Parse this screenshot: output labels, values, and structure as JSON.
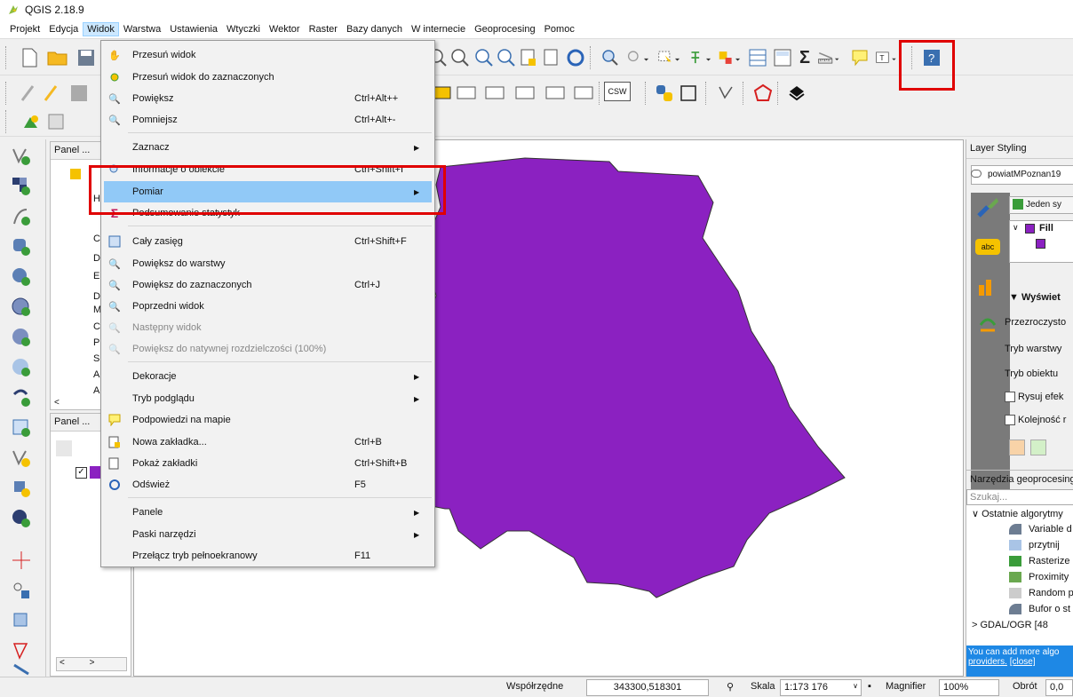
{
  "app": {
    "title": "QGIS 2.18.9"
  },
  "menubar": [
    "Projekt",
    "Edycja",
    "Widok",
    "Warstwa",
    "Ustawienia",
    "Wtyczki",
    "Wektor",
    "Raster",
    "Bazy danych",
    "W internecie",
    "Geoprocesing",
    "Pomoc"
  ],
  "menubar_active": "Widok",
  "view_menu": [
    {
      "label": "Przesuń widok",
      "shortcut": "",
      "icon": "hand-icon"
    },
    {
      "label": "Przesuń widok do zaznaczonych",
      "shortcut": "",
      "icon": "pan-to-selected-icon"
    },
    {
      "label": "Powiększ",
      "shortcut": "Ctrl+Alt++",
      "icon": "zoom-in-icon"
    },
    {
      "label": "Pomniejsz",
      "shortcut": "Ctrl+Alt+-",
      "icon": "zoom-out-icon"
    },
    {
      "label": "Zaznacz",
      "shortcut": "",
      "icon": "",
      "submenu": true
    },
    {
      "label": "Informacje o obiekcie",
      "shortcut": "Ctrl+Shift+I",
      "icon": "identify-icon"
    },
    {
      "label": "Pomiar",
      "shortcut": "",
      "icon": "",
      "submenu": true,
      "highlighted": true
    },
    {
      "label": "Podsumowanie statystyk",
      "shortcut": "",
      "icon": "sigma-icon"
    },
    {
      "label": "Cały zasięg",
      "shortcut": "Ctrl+Shift+F",
      "icon": "zoom-full-icon"
    },
    {
      "label": "Powiększ do warstwy",
      "shortcut": "",
      "icon": "zoom-layer-icon"
    },
    {
      "label": "Powiększ do zaznaczonych",
      "shortcut": "Ctrl+J",
      "icon": "zoom-selected-icon"
    },
    {
      "label": "Poprzedni widok",
      "shortcut": "",
      "icon": "zoom-last-icon"
    },
    {
      "label": "Następny widok",
      "shortcut": "",
      "icon": "zoom-next-icon",
      "disabled": true
    },
    {
      "label": "Powiększ do natywnej rozdzielczości (100%)",
      "shortcut": "",
      "icon": "zoom-native-icon",
      "disabled": true
    },
    {
      "label": "Dekoracje",
      "shortcut": "",
      "icon": "",
      "submenu": true
    },
    {
      "label": "Tryb podglądu",
      "shortcut": "",
      "icon": "",
      "submenu": true
    },
    {
      "label": "Podpowiedzi na mapie",
      "shortcut": "",
      "icon": "map-tips-icon"
    },
    {
      "label": "Nowa zakładka...",
      "shortcut": "Ctrl+B",
      "icon": "new-bookmark-icon"
    },
    {
      "label": "Pokaż zakładki",
      "shortcut": "Ctrl+Shift+B",
      "icon": "show-bookmarks-icon"
    },
    {
      "label": "Odśwież",
      "shortcut": "F5",
      "icon": "refresh-icon"
    },
    {
      "label": "Panele",
      "shortcut": "",
      "icon": "",
      "submenu": true
    },
    {
      "label": "Paski narzędzi",
      "shortcut": "",
      "icon": "",
      "submenu": true
    },
    {
      "label": "Przełącz tryb pełnoekranowy",
      "shortcut": "F11",
      "icon": ""
    }
  ],
  "panels": {
    "browser_title": "Panel ...",
    "layers_title": "Panel ...",
    "browser_letters": [
      "H",
      "C",
      "D",
      "E",
      "D",
      "M",
      "C",
      "P",
      "S",
      "A",
      "A"
    ]
  },
  "layer_styling": {
    "title": "Layer Styling",
    "layer_name": "powiatMPoznan19",
    "renderer": "Jeden sy",
    "fill_label": "Fill",
    "section": "Wyświet",
    "opacity": "Przezroczysto",
    "layer_mode": "Tryb warstwy",
    "object_mode": "Tryb obiektu",
    "effects": "Rysuj efek",
    "order": "Kolejność r",
    "fill_color": "#8b21c1"
  },
  "geoprocessing": {
    "title": "Narzędzia geoprocesing",
    "search_placeholder": "Szukaj...",
    "recent": "Ostatnie algorytmy",
    "items": [
      "Variable d",
      "przytnij",
      "Rasterize",
      "Proximity",
      "Random p",
      "Bufor o st",
      "GDAL/OGR [48"
    ],
    "info": "You can add more algo",
    "info_link": "providers.",
    "info_close": "[close]"
  },
  "statusbar": {
    "coords_label": "Współrzędne",
    "coords_value": "343300,518301",
    "scale_label": "Skala",
    "scale_value": "1:173 176",
    "magnifier_label": "Magnifier",
    "magnifier_value": "100%",
    "rotation_label": "Obrót",
    "rotation_value": "0,0"
  },
  "toolbar": {
    "csw_label": "CSW",
    "text_label": "T"
  },
  "colors": {
    "polygon": "#8b21c1",
    "highlight": "#91c9f7",
    "annotation": "#e00000"
  }
}
